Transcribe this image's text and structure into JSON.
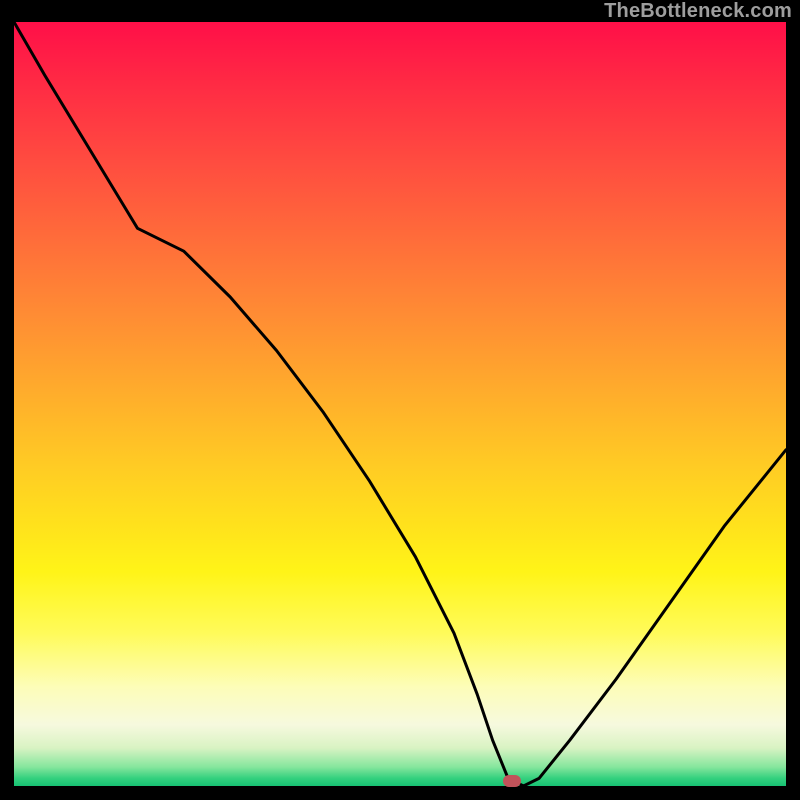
{
  "watermark": "TheBottleneck.com",
  "marker": {
    "x_pct": 64.5,
    "y_pct": 99.3,
    "color": "#c1525a"
  },
  "chart_data": {
    "type": "line",
    "title": "",
    "xlabel": "",
    "ylabel": "",
    "xlim": [
      0,
      100
    ],
    "ylim": [
      0,
      100
    ],
    "grid": false,
    "legend": false,
    "annotations": [
      "TheBottleneck.com"
    ],
    "series": [
      {
        "name": "bottleneck-curve",
        "x": [
          0,
          4,
          10,
          16,
          22,
          28,
          34,
          40,
          46,
          52,
          57,
          60,
          62,
          64,
          66,
          68,
          72,
          78,
          85,
          92,
          100
        ],
        "values": [
          100,
          93,
          83,
          73,
          70,
          64,
          57,
          49,
          40,
          30,
          20,
          12,
          6,
          1,
          0,
          1,
          6,
          14,
          24,
          34,
          44
        ]
      }
    ],
    "background_gradient": {
      "orientation": "vertical",
      "stops": [
        {
          "pct": 0,
          "color": "#ff0f48"
        },
        {
          "pct": 18,
          "color": "#ff4b40"
        },
        {
          "pct": 38,
          "color": "#ff8b34"
        },
        {
          "pct": 58,
          "color": "#ffcb24"
        },
        {
          "pct": 72,
          "color": "#fff418"
        },
        {
          "pct": 87,
          "color": "#fdfdb8"
        },
        {
          "pct": 95,
          "color": "#d9f3c3"
        },
        {
          "pct": 100,
          "color": "#17c173"
        }
      ]
    },
    "marker_point": {
      "x": 64.5,
      "y": 0
    }
  }
}
